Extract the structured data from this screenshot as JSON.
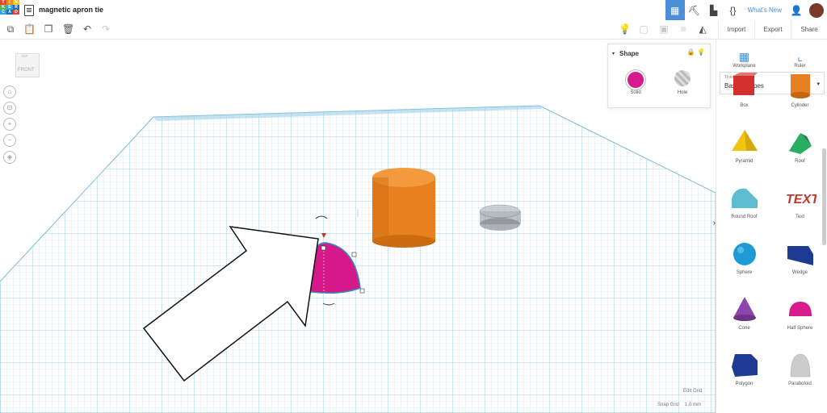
{
  "app": {
    "logo_letters": [
      "T",
      "I",
      "N",
      "K",
      "E",
      "R",
      "C",
      "A",
      "D"
    ],
    "logo_colors": [
      "#e2492a",
      "#f08b1d",
      "#f2c41c",
      "#6ab04c",
      "#2ea7d9",
      "#1f6fb6",
      "#2ea7d9",
      "#1f6fb6",
      "#e2492a"
    ],
    "doc_title": "magnetic apron tie",
    "whats_new": "What's New"
  },
  "tabs": [
    "Import",
    "Export",
    "Share"
  ],
  "shape_panel": {
    "title": "Shape",
    "solid_label": "Solid",
    "hole_label": "Hole",
    "solid_color": "#d81b8c"
  },
  "viewcube": {
    "label": "FRONT",
    "top_label": "TOP"
  },
  "sidebar": {
    "workplane_label": "Workplane",
    "ruler_label": "Ruler",
    "category_small": "Tinkercad",
    "category": "Basic Shapes",
    "shapes": [
      {
        "label": "Box",
        "icon": "box-icon",
        "color": "#d32f2f"
      },
      {
        "label": "Cylinder",
        "icon": "cylinder-icon",
        "color": "#e67e22"
      },
      {
        "label": "Pyramid",
        "icon": "pyramid-icon",
        "color": "#f1c40f"
      },
      {
        "label": "Roof",
        "icon": "roof-icon",
        "color": "#27ae60"
      },
      {
        "label": "Round Roof",
        "icon": "round-roof-icon",
        "color": "#5dbcd2"
      },
      {
        "label": "Text",
        "icon": "text-icon",
        "color": "#c0392b"
      },
      {
        "label": "Sphere",
        "icon": "sphere-icon",
        "color": "#1e9bd7"
      },
      {
        "label": "Wedge",
        "icon": "wedge-icon",
        "color": "#1f3a93"
      },
      {
        "label": "Cone",
        "icon": "cone-icon",
        "color": "#8e44ad"
      },
      {
        "label": "Half Sphere",
        "icon": "half-sphere-icon",
        "color": "#d81b8c"
      },
      {
        "label": "Polygon",
        "icon": "polygon-icon",
        "color": "#1f3a93"
      },
      {
        "label": "Paraboloid",
        "icon": "paraboloid-icon",
        "color": "#cccccc"
      }
    ]
  },
  "footer": {
    "edit_grid": "Edit Grid",
    "snap_grid_label": "Snap Grid",
    "snap_grid_value": "1.0 mm"
  }
}
